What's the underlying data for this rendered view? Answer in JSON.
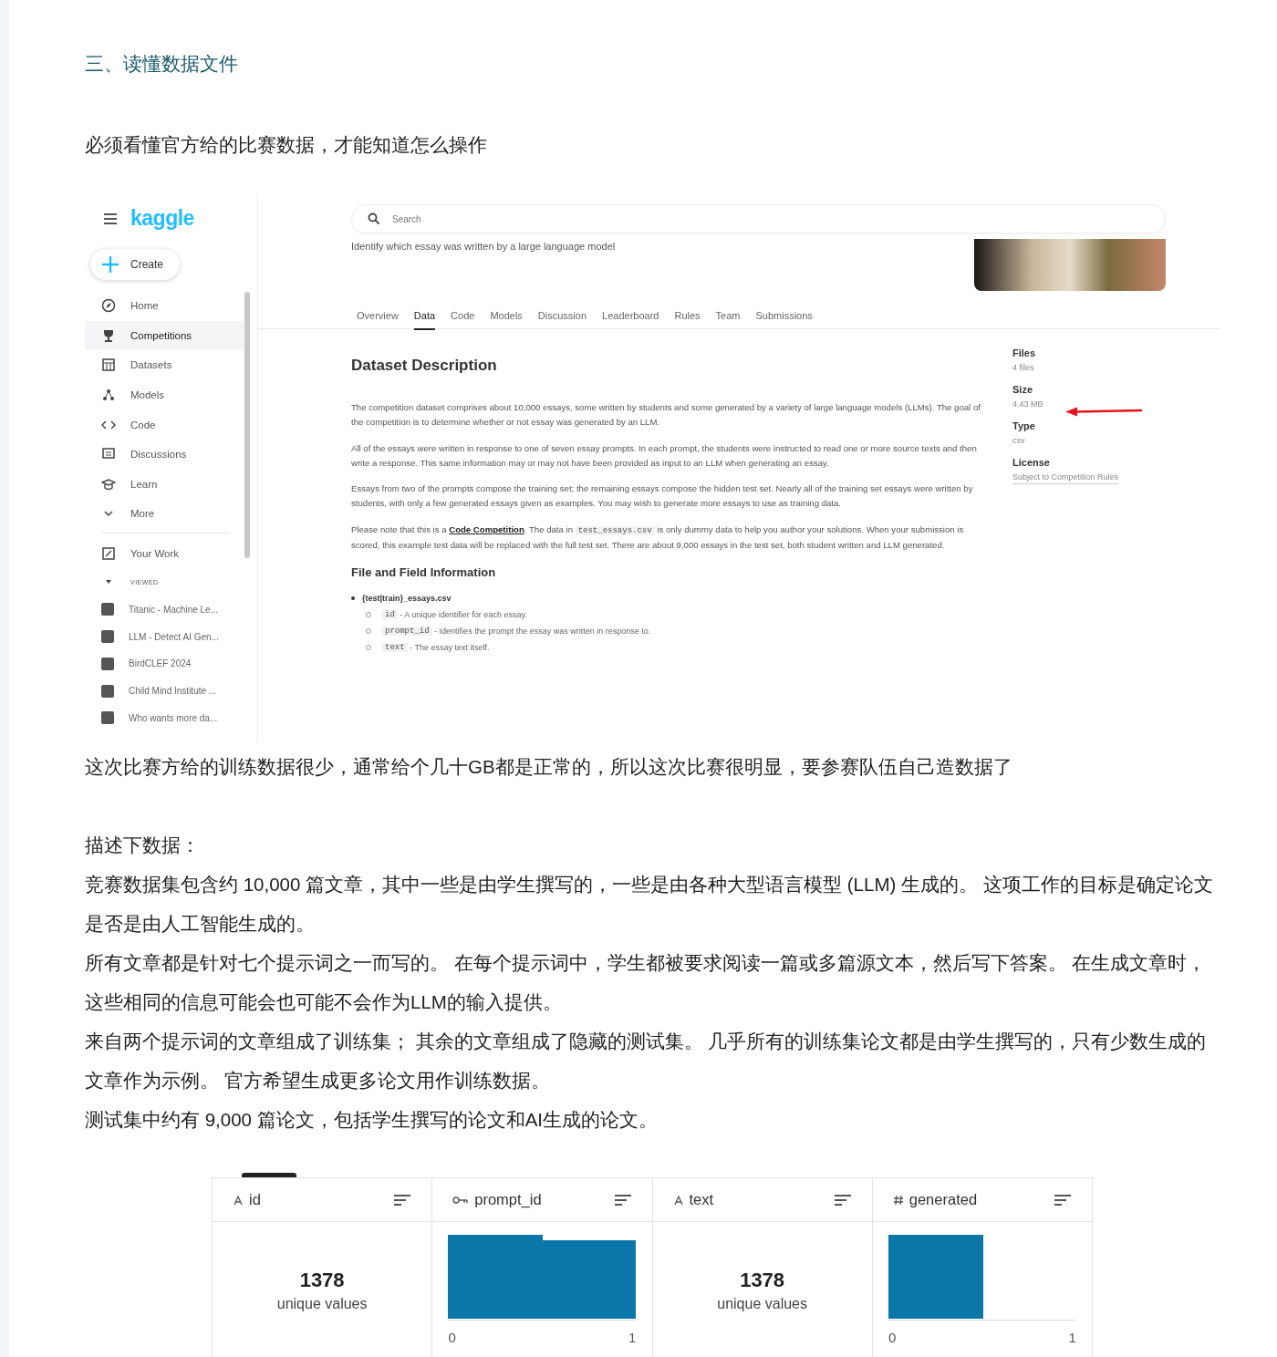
{
  "heading": "三、读懂数据文件",
  "intro": "必须看懂官方给的比赛数据，才能知道怎么操作",
  "kaggle": {
    "logo": "kaggle",
    "create": "Create",
    "nav": [
      {
        "label": "Home",
        "selected": false
      },
      {
        "label": "Competitions",
        "selected": true
      },
      {
        "label": "Datasets",
        "selected": false
      },
      {
        "label": "Models",
        "selected": false
      },
      {
        "label": "Code",
        "selected": false
      },
      {
        "label": "Discussions",
        "selected": false
      },
      {
        "label": "Learn",
        "selected": false
      },
      {
        "label": "More",
        "selected": false
      }
    ],
    "your_work": "Your Work",
    "viewed_label": "VIEWED",
    "viewed": [
      "Titanic - Machine Le...",
      "LLM - Detect AI Gen...",
      "BirdCLEF 2024",
      "Child Mind Institute ...",
      "Who wants more da..."
    ],
    "search": {
      "placeholder": "Search"
    },
    "subtitle": "Identify which essay was written by a large language model",
    "tabs": [
      {
        "label": "Overview",
        "selected": false
      },
      {
        "label": "Data",
        "selected": true
      },
      {
        "label": "Code",
        "selected": false
      },
      {
        "label": "Models",
        "selected": false
      },
      {
        "label": "Discussion",
        "selected": false
      },
      {
        "label": "Leaderboard",
        "selected": false
      },
      {
        "label": "Rules",
        "selected": false
      },
      {
        "label": "Team",
        "selected": false
      },
      {
        "label": "Submissions",
        "selected": false
      }
    ],
    "description_title": "Dataset Description",
    "paragraphs": [
      [
        {
          "kind": "plain",
          "text": "The competition dataset comprises about 10,000 essays, some written by students and some generated by a variety of large language models (LLMs). The goal of the competition is to determine whether or not essay was generated by an LLM."
        }
      ],
      [
        {
          "kind": "plain",
          "text": "All of the essays were written in response to one of seven essay prompts. In each prompt, the students were instructed to read one or more source texts and then write a response. This same information may or may not have been provided as input to an LLM when generating an essay."
        }
      ],
      [
        {
          "kind": "plain",
          "text": "Essays from two of the prompts compose the training set; the remaining essays compose the hidden test set. Nearly all of the training set essays were written by students, with only a few generated essays given as examples. You may wish to generate more essays to use as training data."
        }
      ],
      [
        {
          "kind": "plain",
          "text": "Please note that this is a "
        },
        {
          "kind": "bold",
          "text": "Code Competition"
        },
        {
          "kind": "plain",
          "text": ". The data in "
        },
        {
          "kind": "code",
          "text": "test_essays.csv"
        },
        {
          "kind": "plain",
          "text": " is only dummy data to help you author your solutions. When your submission is scored, this example test data will be replaced with the full test set. There are about 9,000 essays in the test set, both student written and LLM generated."
        }
      ]
    ],
    "file_info_title": "File and Field Information",
    "file_name": "{test|train}_essays.csv",
    "fields": [
      {
        "code": "id",
        "text": " - A unique identifier for each essay."
      },
      {
        "code": "prompt_id",
        "text": " - Identifies the prompt the essay was written in response to."
      },
      {
        "code": "text",
        "text": " - The essay text itself."
      }
    ],
    "meta": [
      {
        "label": "Files",
        "value": "4 files"
      },
      {
        "label": "Size",
        "value": "4.43 MB"
      },
      {
        "label": "Type",
        "value": "csv"
      },
      {
        "label": "License",
        "value": "Subject to Competition Rules"
      }
    ]
  },
  "note": "这次比赛方给的训练数据很少，通常给个几十GB都是正常的，所以这次比赛很明显，要参赛队伍自己造数据了",
  "desc_label": "描述下数据：",
  "desc_paragraphs": [
    "竞赛数据集包含约 10,000 篇文章，其中一些是由学生撰写的，一些是由各种大型语言模型 (LLM) 生成的。 这项工作的目标是确定论文是否是由人工智能生成的。",
    "所有文章都是针对七个提示词之一而写的。 在每个提示词中，学生都被要求阅读一篇或多篇源文本，然后写下答案。 在生成文章时，这些相同的信息可能会也可能不会作为LLM的输入提供。",
    "来自两个提示词的文章组成了训练集； 其余的文章组成了隐藏的测试集。 几乎所有的训练集论文都是由学生撰写的，只有少数生成的文章作为示例。 官方希望生成更多论文用作训练数据。",
    "测试集中约有 9,000 篇论文，包括学生撰写的论文和AI生成的论文。"
  ],
  "table": {
    "columns": [
      {
        "name": "id",
        "kind": "string",
        "summary": {
          "kind": "count",
          "count": "1378",
          "caption": "unique values"
        }
      },
      {
        "name": "prompt_id",
        "kind": "key",
        "summary": {
          "kind": "histogram",
          "min": "0",
          "max": "1"
        }
      },
      {
        "name": "text",
        "kind": "string",
        "summary": {
          "kind": "count",
          "count": "1378",
          "caption": "unique values"
        }
      },
      {
        "name": "generated",
        "kind": "number",
        "summary": {
          "kind": "histogram",
          "min": "0",
          "max": "1"
        }
      }
    ]
  }
}
